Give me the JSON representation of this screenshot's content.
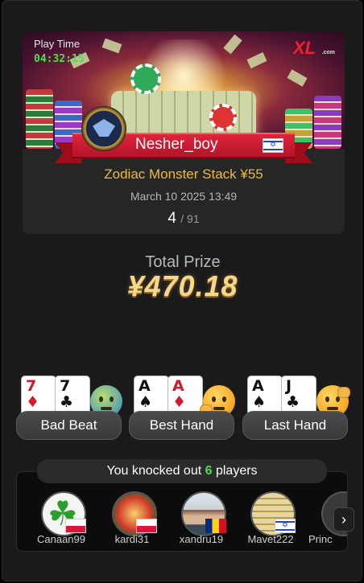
{
  "play_time": {
    "label": "Play Time",
    "value": "04:32:15"
  },
  "brand": {
    "logo_text": "XL",
    "logo_suffix": ".com"
  },
  "player": {
    "name": "Nesher_boy",
    "flag": "israel-flag"
  },
  "tournament": {
    "name": "Zodiac Monster Stack ¥55",
    "date": "March 10 2025 13:49",
    "finish_position": "4",
    "finish_total": "/ 91"
  },
  "prize": {
    "label": "Total Prize",
    "value": "¥470.18"
  },
  "actions": [
    {
      "label": "Bad Beat",
      "cards": [
        {
          "rank": "7",
          "suit": "♦",
          "color": "#d3182a"
        },
        {
          "rank": "7",
          "suit": "♣",
          "color": "#111111"
        }
      ],
      "emoji": "sick-face-icon"
    },
    {
      "label": "Best Hand",
      "cards": [
        {
          "rank": "A",
          "suit": "♠",
          "color": "#111111"
        },
        {
          "rank": "A",
          "suit": "♦",
          "color": "#d3182a"
        }
      ],
      "emoji": "thinking-face-icon"
    },
    {
      "label": "Last Hand",
      "cards": [
        {
          "rank": "A",
          "suit": "♠",
          "color": "#111111"
        },
        {
          "rank": "J",
          "suit": "♣",
          "color": "#111111"
        }
      ],
      "emoji": "salute-face-icon"
    }
  ],
  "knockouts": {
    "text_before": "You knocked out ",
    "count": "6",
    "text_after": " players",
    "players": [
      {
        "name": "Canaan99",
        "flag": "poland-flag"
      },
      {
        "name": "kardi31",
        "flag": "poland-flag"
      },
      {
        "name": "xandru19",
        "flag": "romania-flag"
      },
      {
        "name": "Mavet222",
        "flag": "israel-flag"
      },
      {
        "name": "Princ"
      }
    ],
    "next_arrow": "›"
  },
  "colors": {
    "accent_gold": "#f0b93a",
    "success_green": "#4be04b",
    "ribbon_red": "#d01c30"
  }
}
